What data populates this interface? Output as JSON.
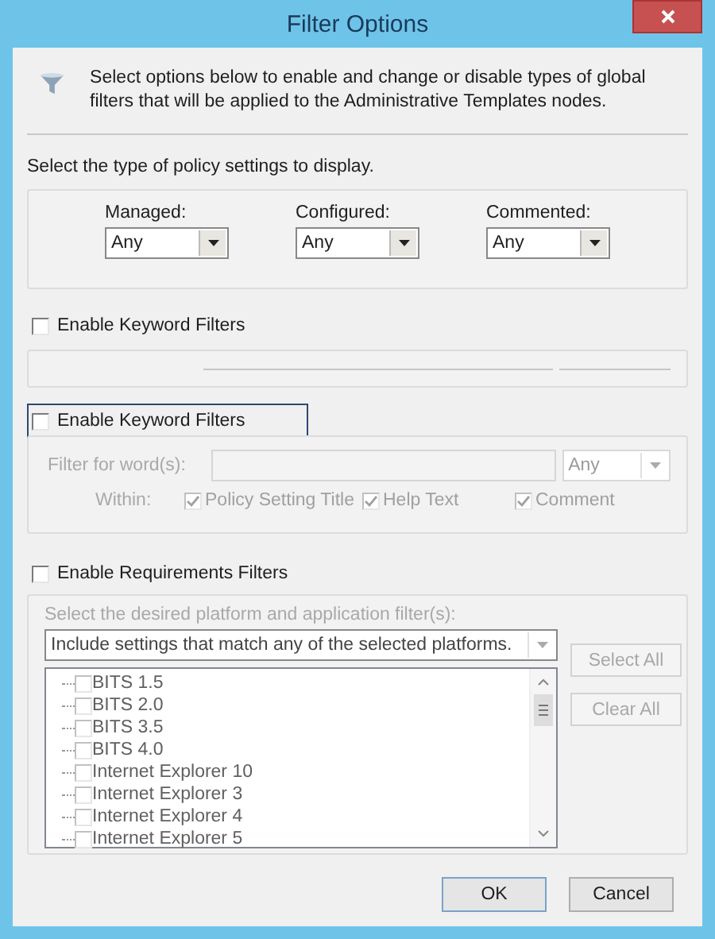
{
  "window": {
    "title": "Filter Options"
  },
  "intro": "Select options below to enable and change or disable types of global filters that will be applied to the Administrative Templates nodes.",
  "policy_type": {
    "label": "Select the type of policy settings to display.",
    "dropdowns": [
      {
        "label": "Managed:",
        "value": "Any"
      },
      {
        "label": "Configured:",
        "value": "Any"
      },
      {
        "label": "Commented:",
        "value": "Any"
      }
    ]
  },
  "keyword_filters_upper": {
    "label": "Enable Keyword Filters",
    "checked": false
  },
  "keyword_filters": {
    "label": "Enable Keyword Filters",
    "checked": false,
    "focused": true,
    "disabled": true,
    "filter_label": "Filter for word(s):",
    "match": "Any",
    "within_label": "Within:",
    "within": [
      {
        "label": "Policy Setting Title",
        "checked": true
      },
      {
        "label": "Help Text",
        "checked": true
      },
      {
        "label": "Comment",
        "checked": true
      }
    ]
  },
  "requirements": {
    "label": "Enable Requirements Filters",
    "checked": false,
    "disabled": true,
    "prompt": "Select the desired platform and application filter(s):",
    "match_mode": "Include settings that match any of the selected platforms.",
    "platforms": [
      {
        "label": "BITS 1.5",
        "checked": false
      },
      {
        "label": "BITS 2.0",
        "checked": false
      },
      {
        "label": "BITS 3.5",
        "checked": false
      },
      {
        "label": "BITS 4.0",
        "checked": false
      },
      {
        "label": "Internet Explorer 10",
        "checked": false
      },
      {
        "label": "Internet Explorer 3",
        "checked": false
      },
      {
        "label": "Internet Explorer 4",
        "checked": false
      },
      {
        "label": "Internet Explorer 5",
        "checked": false
      }
    ],
    "buttons": [
      "Select All",
      "Clear All"
    ]
  },
  "buttons": [
    "OK",
    "Cancel"
  ]
}
